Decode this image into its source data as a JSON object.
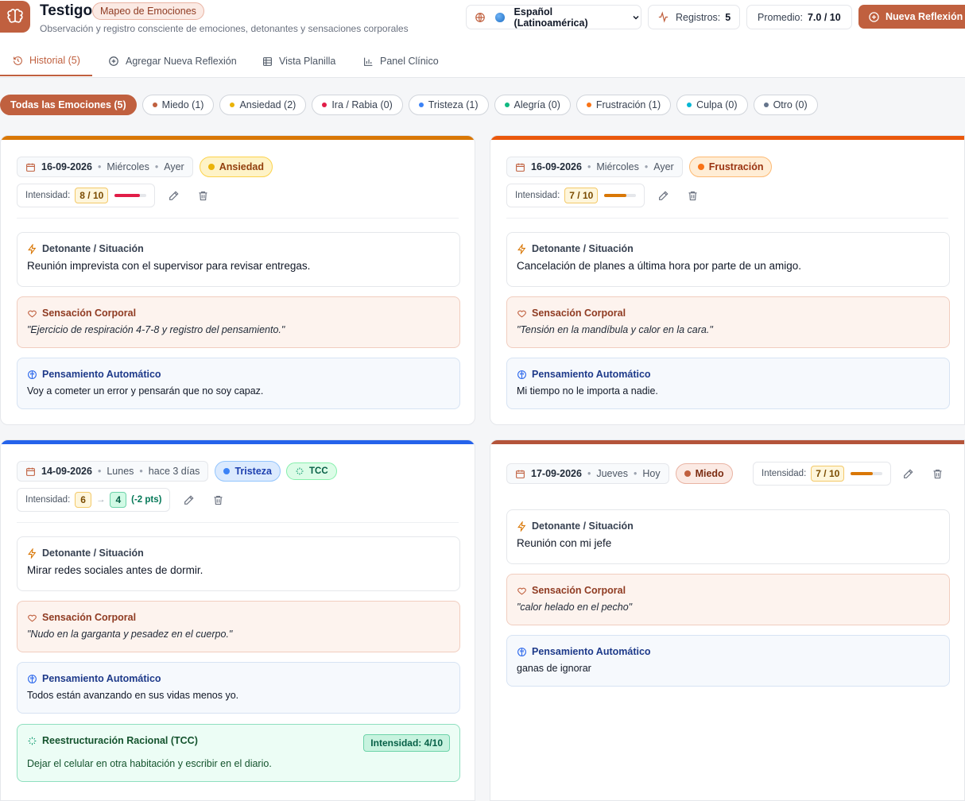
{
  "header": {
    "title": "Testigo",
    "badge": "Mapeo de Emociones",
    "subtitle": "Observación y registro consciente de emociones, detonantes y sensaciones corporales",
    "language": "Español (Latinoamérica)",
    "registros_label": "Registros:",
    "registros_value": "5",
    "promedio_label": "Promedio:",
    "promedio_value": "7.0 / 10",
    "new_button": "Nueva Reflexión"
  },
  "tabs": [
    {
      "label": "Historial (5)",
      "active": true
    },
    {
      "label": "Agregar Nueva Reflexión"
    },
    {
      "label": "Vista Planilla"
    },
    {
      "label": "Panel Clínico"
    }
  ],
  "filters": [
    {
      "label": "Todas las Emociones (5)",
      "active": true
    },
    {
      "label": "Miedo (1)",
      "color": "#c0603f"
    },
    {
      "label": "Ansiedad (2)",
      "color": "#eab308"
    },
    {
      "label": "Ira / Rabia (0)",
      "color": "#e11d48"
    },
    {
      "label": "Tristeza (1)",
      "color": "#3b82f6"
    },
    {
      "label": "Alegría (0)",
      "color": "#10b981"
    },
    {
      "label": "Frustración (1)",
      "color": "#f97316"
    },
    {
      "label": "Culpa (0)",
      "color": "#06b6d4"
    },
    {
      "label": "Otro (0)",
      "color": "#64748b"
    }
  ],
  "labels": {
    "intensity": "Intensidad:",
    "trigger": "Detonante / Situación",
    "body": "Sensación Corporal",
    "thought": "Pensamiento Automático",
    "tcc_section": "Reestructuración Racional (TCC)",
    "tcc_tag": "TCC"
  },
  "cards": [
    {
      "date": "16-09-2026",
      "weekday": "Miércoles",
      "relative": "Ayer",
      "emotion": "Ansiedad",
      "accent": "#d97706",
      "intensity": "8 / 10",
      "intensity_level": 0.8,
      "fill_color": "#e11d48",
      "trigger": "Reunión imprevista con el supervisor para revisar entregas.",
      "body": "\"Ejercicio de respiración 4-7-8 y registro del pensamiento.\"",
      "thought": "Voy a cometer un error y pensarán que no soy capaz."
    },
    {
      "date": "16-09-2026",
      "weekday": "Miércoles",
      "relative": "Ayer",
      "emotion": "Frustración",
      "accent": "#ea580c",
      "intensity": "7 / 10",
      "intensity_level": 0.7,
      "fill_color": "#d97706",
      "trigger": "Cancelación de planes a última hora por parte de un amigo.",
      "body": "\"Tensión en la mandíbula y calor en la cara.\"",
      "thought": "Mi tiempo no le importa a nadie."
    },
    {
      "date": "14-09-2026",
      "weekday": "Lunes",
      "relative": "hace 3 días",
      "emotion": "Tristeza",
      "accent": "#2563eb",
      "intensity_before": "6",
      "intensity_after": "4",
      "intensity_change": "(-2 pts)",
      "trigger": "Mirar redes sociales antes de dormir.",
      "body": "\"Nudo en la garganta y pesadez en el cuerpo.\"",
      "thought": "Todos están avanzando en sus vidas menos yo.",
      "tcc_intensity": "Intensidad: 4/10",
      "tcc_text": "Dejar el celular en otra habitación y escribir en el diario."
    },
    {
      "date": "17-09-2026",
      "weekday": "Jueves",
      "relative": "Hoy",
      "emotion": "Miedo",
      "accent": "#b4543a",
      "intensity": "7 / 10",
      "intensity_level": 0.7,
      "fill_color": "#d97706",
      "trigger": "Reunión con mi jefe",
      "body": "\"calor helado en el pecho\"",
      "thought": "ganas de ignorar"
    }
  ]
}
